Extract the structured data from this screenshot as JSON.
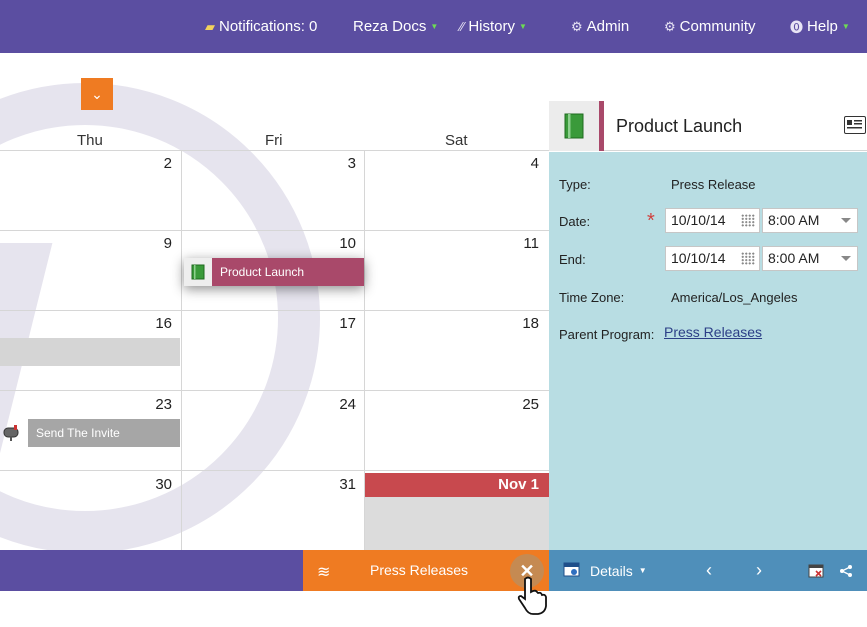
{
  "nav": {
    "notifications": "Notifications: 0",
    "docs": "Reza Docs",
    "history": "History",
    "admin": "Admin",
    "community": "Community",
    "help": "Help"
  },
  "calendar": {
    "weekdays": [
      "Thu",
      "Fri",
      "Sat"
    ],
    "weeks": [
      [
        "2",
        "3",
        "4"
      ],
      [
        "9",
        "10",
        "11"
      ],
      [
        "16",
        "17",
        "18"
      ],
      [
        "23",
        "24",
        "25"
      ],
      [
        "30",
        "31",
        "Nov 1"
      ]
    ],
    "events": {
      "product_launch": "Product Launch",
      "send_invite": "Send The Invite"
    }
  },
  "bottom": {
    "tab_label": "Press Releases",
    "close": "✕"
  },
  "panel": {
    "title": "Product Launch",
    "type_label": "Type:",
    "type_value": "Press Release",
    "date_label": "Date:",
    "date_value": "10/10/14",
    "date_time": "8:00 AM",
    "end_label": "End:",
    "end_value": "10/10/14",
    "end_time": "8:00 AM",
    "tz_label": "Time Zone:",
    "tz_value": "America/Los_Angeles",
    "parent_label": "Parent Program:",
    "parent_link": "Press Releases",
    "details": "Details"
  }
}
